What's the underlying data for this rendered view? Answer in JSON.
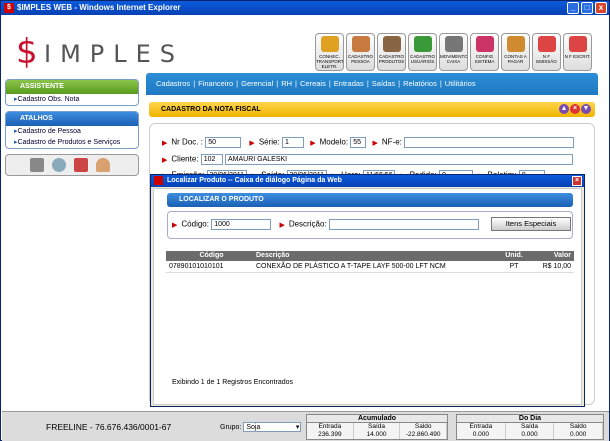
{
  "window": {
    "title": "$IMPLES WEB - Windows Internet Explorer",
    "min": "_",
    "max": "□",
    "close": "x"
  },
  "brand": {
    "first": "$",
    "rest": "IMPLES"
  },
  "tools": [
    {
      "label": "CONHEC. TRANSPORTE ELETR.",
      "color": "#e0a020"
    },
    {
      "label": "CADASTRO PESSOA",
      "color": "#c87a40"
    },
    {
      "label": "CADASTRO PRODUTOS",
      "color": "#886644"
    },
    {
      "label": "CADASTRO USUÁRIOS",
      "color": "#3a9a3a"
    },
    {
      "label": "MOVIMENTO CAIXA",
      "color": "#777777"
    },
    {
      "label": "CONFIG SISTEMA",
      "color": "#cc3366"
    },
    {
      "label": "CONTAS A PAGAR",
      "color": "#d08a30"
    },
    {
      "label": "N F EMISSÃO",
      "color": "#dd4444"
    },
    {
      "label": "N F ESCRIT.",
      "color": "#dd4444"
    }
  ],
  "sidebar": {
    "assistente_title": "ASSISTENTE",
    "assistente_items": [
      "Cadastro Obs. Nota"
    ],
    "atalhos_title": "ATALHOS",
    "atalhos_items": [
      "Cadastro de Pessoa",
      "Cadastro de Produtos e Serviços"
    ],
    "icons": [
      "calculator-icon",
      "search-icon",
      "calendar-icon",
      "user-icon"
    ]
  },
  "nav": [
    "Cadastros",
    "Financeiro",
    "Gerencial",
    "RH",
    "Cereais",
    "Entradas",
    "Saídas",
    "Relatórios",
    "Utilitários"
  ],
  "section": {
    "title": "CADASTRO DA NOTA FISCAL"
  },
  "form": {
    "nr_doc_label": "Nr Doc. :",
    "nr_doc": "50",
    "serie_label": "Série:",
    "serie": "1",
    "modelo_label": "Modelo:",
    "modelo": "55",
    "nfe_label": "NF-e:",
    "nfe": "",
    "cliente_label": "Cliente:",
    "cliente_cod": "102",
    "cliente_nome": "AMAURI GALESKI",
    "emissao_label": "Emissão:",
    "emissao": "30/06/2011",
    "saida_label": "Saída:",
    "saida": "30/06/2011",
    "hora_label": "Hora:",
    "hora": "11:56:56",
    "pedido_label": "Pedido:",
    "pedido": "0",
    "boletim_label": "Boletim:",
    "boletim": "0"
  },
  "dialog": {
    "title": "Localizar Produto -- Caixa de diálogo Página da Web",
    "header": "LOCALIZAR O PRODUTO",
    "codigo_label": "Código:",
    "codigo": "1000",
    "descricao_label": "Descrição:",
    "descricao": "",
    "itens_button": "Itens Especiais",
    "columns": [
      "Código",
      "Descrição",
      "Unid.",
      "Valor Unitário"
    ],
    "rows": [
      [
        "07890101010101",
        "CONEXÃO DE PLÁSTICO A T-TAPE LAYF 500-00 LFT NCM",
        "PT",
        "R$ 10,00"
      ]
    ],
    "found": "Exibindo 1 de 1 Registros Encontrados"
  },
  "footer": {
    "freeline": "FREELINE - 76.676.436/0001-67",
    "grupo_label": "Grupo:",
    "grupo": "Soja",
    "acumulado": {
      "title": "Acumulado",
      "cols": [
        "Entrada",
        "Saída",
        "Saldo"
      ],
      "vals": [
        "236.399",
        "14.000",
        "-22.860.490"
      ]
    },
    "dodia": {
      "title": "Do Dia",
      "cols": [
        "Entrada",
        "Saída",
        "Saldo"
      ],
      "vals": [
        "0.000",
        "0.000",
        "0.000"
      ]
    }
  }
}
